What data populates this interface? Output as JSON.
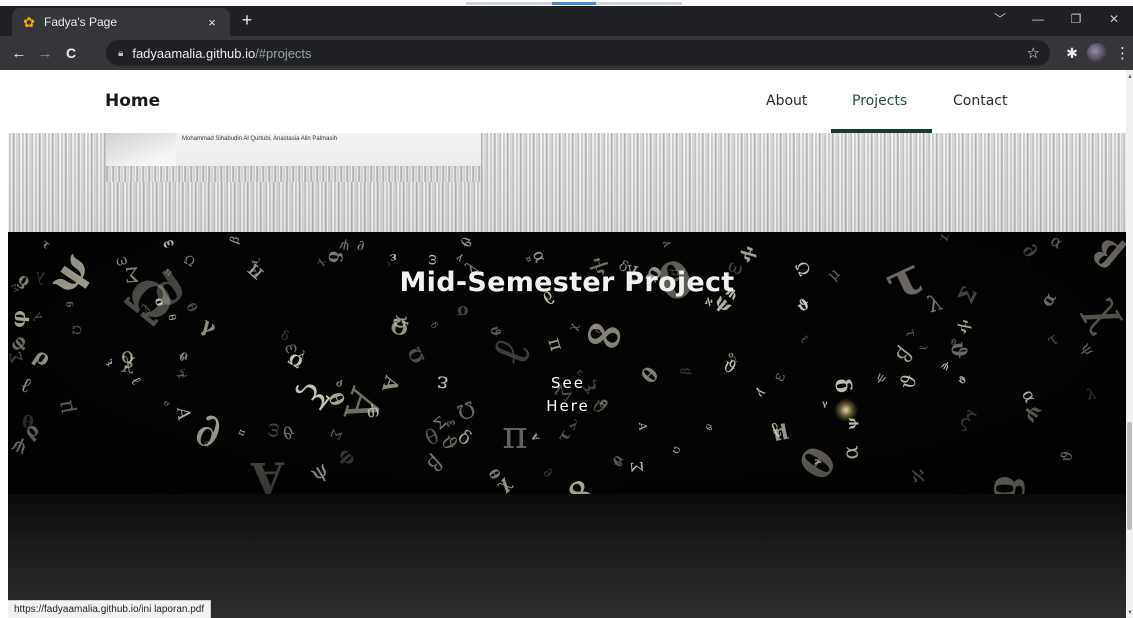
{
  "browser": {
    "tab": {
      "favicon": "sunflower-icon",
      "title": "Fadya's Page",
      "close_glyph": "×"
    },
    "new_tab_glyph": "+",
    "window_controls": {
      "tabsearch": "﹀",
      "minimize": "—",
      "restore": "❐",
      "close": "✕"
    },
    "nav": {
      "back": "←",
      "forward": "→",
      "reload": "C"
    },
    "address": {
      "lock_icon": "lock-icon",
      "host": "fadyaamalia.github.io",
      "path": "/#projects"
    },
    "bookmark_glyph": "☆",
    "extension_glyph": "✱",
    "menu_glyph": "⋮"
  },
  "site": {
    "brand": "Home",
    "nav": [
      {
        "label": "About",
        "active": false
      },
      {
        "label": "Projects",
        "active": true
      },
      {
        "label": "Contact",
        "active": false
      }
    ],
    "paper_authors": "Mohammad Sihabudin Al Qurtubi, Anastasia Alin Palmasih",
    "project_title": "Mid-Semester Project",
    "project_link_line1": "See",
    "project_link_line2": "Here"
  },
  "status_bar": "https://fadyaamalia.github.io/ini laporan.pdf",
  "colors": {
    "chrome_dark": "#202124",
    "chrome_toolbar": "#35363a",
    "nav_active_underline": "#143a34",
    "hero_bg": "#040404",
    "glyph_color": "#d8d3c2"
  }
}
